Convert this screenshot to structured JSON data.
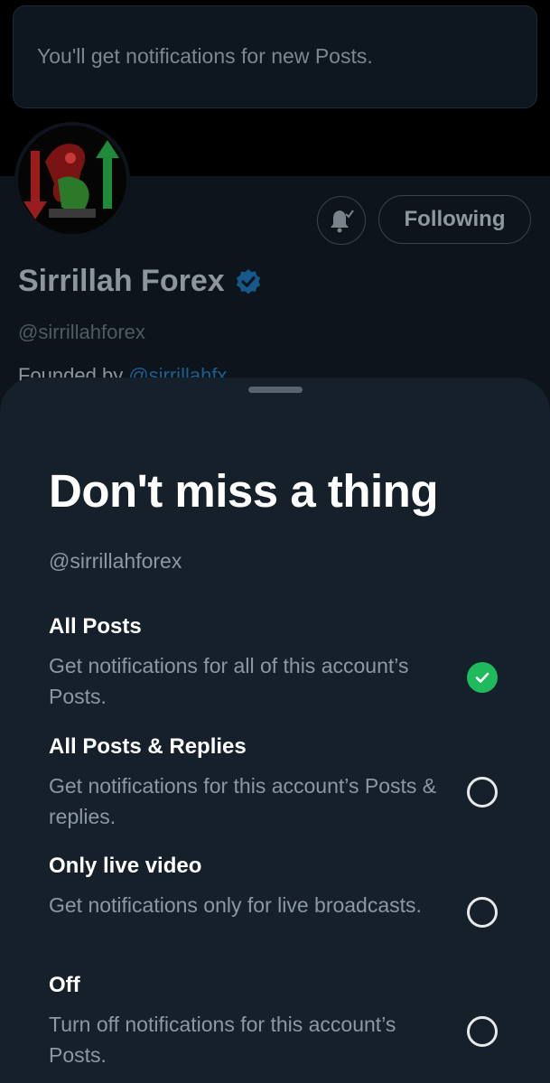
{
  "toast": {
    "message": "You'll get notifications for new Posts."
  },
  "profile": {
    "name": "Sirrillah Forex",
    "handle": "@sirrillahforex",
    "bio_prefix": "Founded by ",
    "bio_mention": "@sirrillahfx",
    "following_label": "Following",
    "verified": true
  },
  "sheet": {
    "title": "Don't miss a thing",
    "handle": "@sirrillahforex",
    "options": [
      {
        "label": "All Posts",
        "description": "Get notifications for all of this account’s Posts.",
        "selected": true
      },
      {
        "label": "All Posts & Replies",
        "description": "Get notifications for this account’s Posts & replies.",
        "selected": false
      },
      {
        "label": "Only live video",
        "description": "Get notifications only for live broadcasts.",
        "selected": false
      },
      {
        "label": "Off",
        "description": "Turn off notifications for this account’s Posts.",
        "selected": false
      }
    ]
  },
  "colors": {
    "accent_selected": "#1fba5c",
    "sheet_background": "#15202b",
    "verified_blue": "#1d9bf0"
  },
  "icons": {
    "notification_bell": "bell-check-icon",
    "verified": "verified-badge-icon",
    "selected": "checkmark-icon"
  }
}
